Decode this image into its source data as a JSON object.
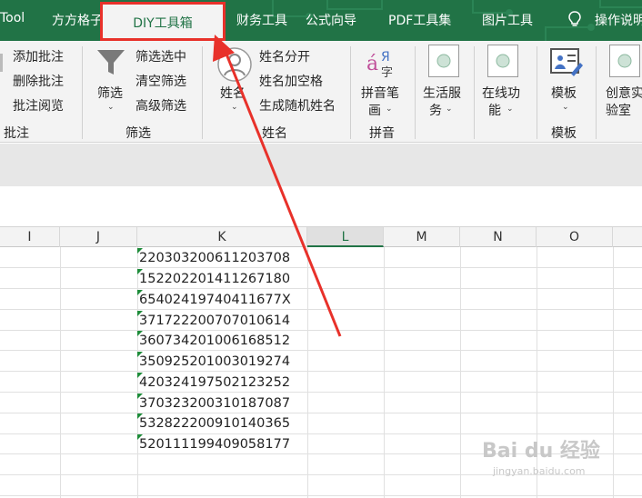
{
  "tabs": {
    "tool": "Tool",
    "fangfang": "方方格子",
    "diy": "DIY工具箱",
    "finance": "财务工具",
    "formula": "公式向导",
    "pdf": "PDF工具集",
    "image": "图片工具",
    "help": "操作说明"
  },
  "ribbon": {
    "comment_add": "添加批注",
    "comment_delete": "删除批注",
    "comment_view": "批注阅览",
    "group_comment": "批注",
    "filter_btn": "筛选",
    "filter_select": "筛选选中",
    "filter_clear": "清空筛选",
    "filter_advanced": "高级筛选",
    "group_filter": "筛选",
    "name_btn": "姓名",
    "name_split": "姓名分开",
    "name_space": "姓名加空格",
    "name_random": "生成随机姓名",
    "group_name": "姓名",
    "pinyin_line1": "拼音笔",
    "pinyin_line2": "画",
    "group_pinyin": "拼音",
    "life_line1": "生活服",
    "life_line2": "务",
    "online_line1": "在线功",
    "online_line2": "能",
    "template_btn": "模板",
    "group_template": "模板",
    "creative_line1": "创意实",
    "creative_line2": "验室"
  },
  "columns": [
    "I",
    "J",
    "K",
    "L",
    "M",
    "N",
    "O"
  ],
  "cells": [
    "220303200611203708",
    "152202201411267180",
    "65402419740411677X",
    "371722200707010614",
    "360734201006168512",
    "350925201003019274",
    "420324197502123252",
    "370323200310187087",
    "532822200910140365",
    "520111199409058177"
  ],
  "watermark": {
    "logo": "Bai du 经验",
    "url": "jingyan.baidu.com"
  },
  "colors": {
    "excel_green": "#217346",
    "highlight_red": "#e8312a",
    "ribbon_bg": "#f3f3f3"
  }
}
